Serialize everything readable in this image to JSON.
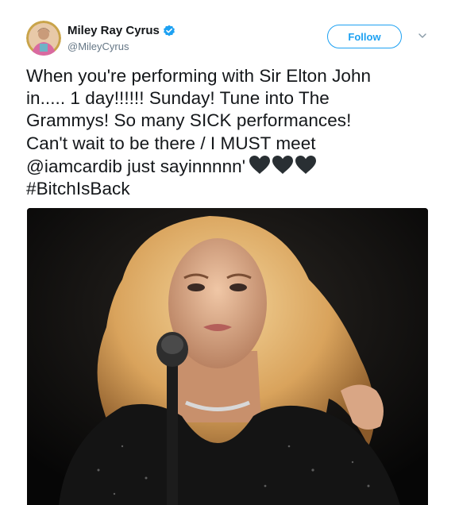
{
  "user": {
    "display_name": "Miley Ray Cyrus",
    "handle": "@MileyCyrus",
    "verified": true,
    "verified_icon": "verified-badge-icon",
    "avatar_icon": "avatar"
  },
  "actions": {
    "follow_label": "Follow",
    "more_icon": "chevron-down-icon"
  },
  "tweet": {
    "line1": "When you're performing with Sir Elton John",
    "line2": "in..... 1 day!!!!!! Sunday! Tune into The",
    "line3": "Grammys! So many SICK performances!",
    "line4": "Can't wait to be there / I MUST meet",
    "line5": "@iamcardib just sayinnnnn'",
    "line6": "#BitchIsBack",
    "heart_icon": "black-heart-icon",
    "heart_count": 3
  },
  "media": {
    "type": "photo",
    "icon": "performer-photo"
  },
  "colors": {
    "accent": "#1da1f2",
    "text": "#14171a",
    "secondary": "#657786"
  }
}
